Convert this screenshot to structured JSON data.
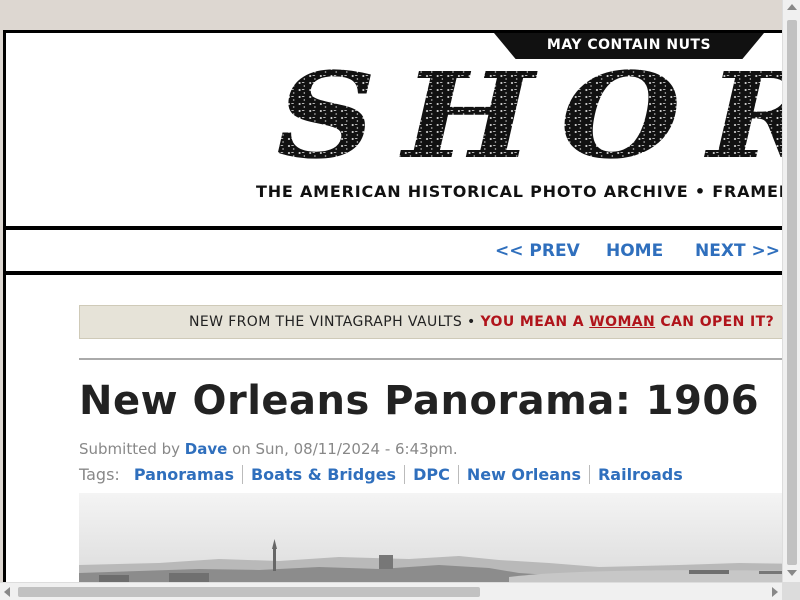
{
  "header": {
    "badge": "MAY CONTAIN NUTS",
    "logo_text": "SHORPY",
    "tagline": "THE AMERICAN HISTORICAL PHOTO ARCHIVE  •  FRAMED PRINTS"
  },
  "nav": {
    "prev": "<< PREV",
    "home": "HOME",
    "next": "NEXT >>"
  },
  "promo": {
    "intro": "NEW FROM THE VINTAGRAPH VAULTS • ",
    "link_pre": "YOU MEAN A ",
    "link_emph": "WOMAN",
    "link_post": " CAN OPEN IT?"
  },
  "article": {
    "title": "New Orleans Panorama: 1906",
    "submitted_by": "Submitted by ",
    "author": "Dave",
    "date": " on Sun, 08/11/2024 - 6:43pm.",
    "tags_label": "Tags:",
    "tags": [
      "Panoramas",
      "Boats & Bridges",
      "DPC",
      "New Orleans",
      "Railroads"
    ]
  },
  "photo": {
    "icon": "panorama-photo"
  }
}
